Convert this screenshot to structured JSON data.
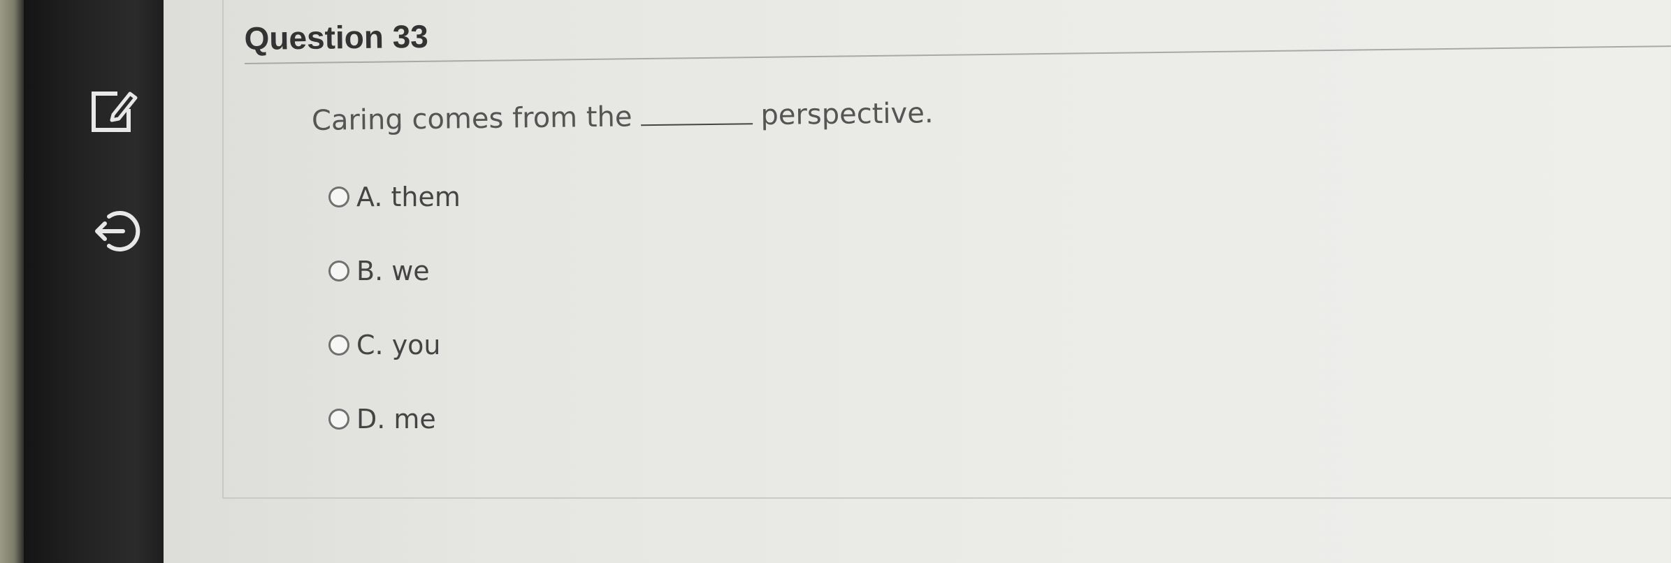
{
  "question": {
    "title": "Question 33",
    "stem_before": "Caring comes from the",
    "stem_after": "perspective."
  },
  "sidebar": {
    "icons": [
      "edit-note-icon",
      "exit-icon"
    ]
  },
  "choices": [
    {
      "label": "A. them",
      "selected": false
    },
    {
      "label": "B. we",
      "selected": false
    },
    {
      "label": "C. you",
      "selected": false
    },
    {
      "label": "D. me",
      "selected": false
    }
  ]
}
